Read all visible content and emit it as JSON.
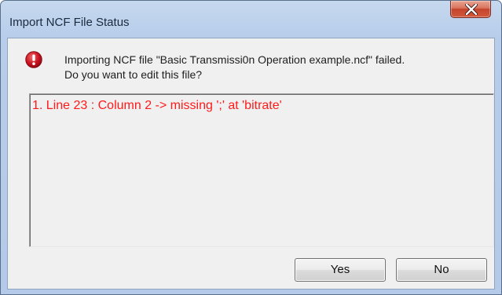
{
  "window": {
    "title": "Import NCF File Status"
  },
  "message": {
    "line1": "Importing NCF file \"Basic Transmissi0n Operation example.ncf\" failed.",
    "line2": "Do you want to edit this file?"
  },
  "errors": [
    "1. Line 23 : Column 2 -> missing ';' at 'bitrate'"
  ],
  "buttons": {
    "yes_label": "Yes",
    "no_label": "No"
  },
  "icons": {
    "close": "close-icon",
    "error": "error-icon"
  },
  "colors": {
    "error_text": "#ff1a1a",
    "error_icon": "#c8101e",
    "close_button": "#c4432c"
  }
}
